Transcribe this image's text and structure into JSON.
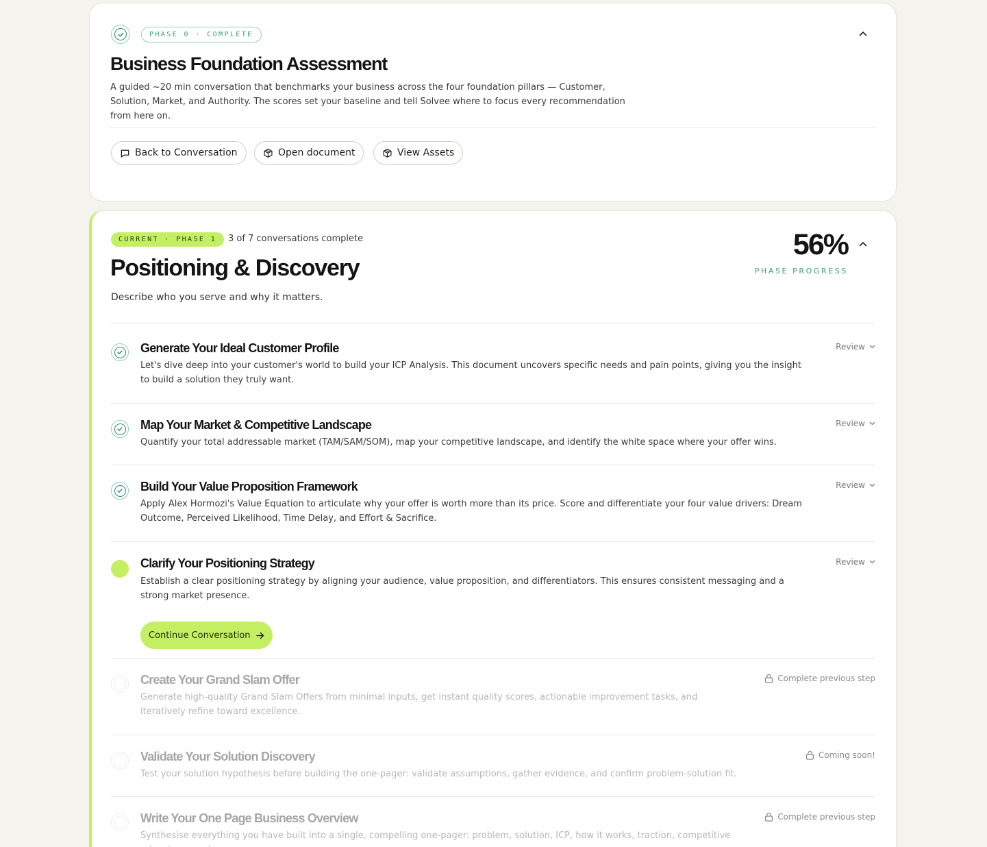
{
  "phase0": {
    "badge": "PHASE 0 · COMPLETE",
    "title": "Business Foundation Assessment",
    "description": "A guided ~20 min conversation that benchmarks your business across the four foundation pillars — Customer, Solution, Market, and Authority. The scores set your baseline and tell Solvee where to focus every recommendation from here on.",
    "buttons": {
      "back": "Back to Conversation",
      "open_document": "Open document",
      "view_assets": "View Assets"
    }
  },
  "phase1": {
    "badge": "CURRENT · PHASE 1",
    "conversations_complete": "3 of 7 conversations complete",
    "title": "Positioning & Discovery",
    "subtitle": "Describe who you serve and why it matters.",
    "progress_value": "56%",
    "progress_label": "PHASE PROGRESS",
    "continue_label": "Continue Conversation",
    "steps": [
      {
        "status": "complete",
        "title": "Generate Your Ideal Customer Profile",
        "description": "Let's dive deep into your customer's world to build your ICP Analysis. This document uncovers specific needs and pain points, giving you the insight to build a solution they truly want.",
        "action": "Review"
      },
      {
        "status": "complete",
        "title": "Map Your Market & Competitive Landscape",
        "description": "Quantify your total addressable market (TAM/SAM/SOM), map your competitive landscape, and identify the white space where your offer wins.",
        "action": "Review"
      },
      {
        "status": "complete",
        "title": "Build Your Value Proposition Framework",
        "description": "Apply Alex Hormozi's Value Equation to articulate why your offer is worth more than its price. Score and differentiate your four value drivers: Dream Outcome, Perceived Likelihood, Time Delay, and Effort & Sacrifice.",
        "action": "Review"
      },
      {
        "status": "active",
        "title": "Clarify Your Positioning Strategy",
        "description": "Establish a clear positioning strategy by aligning your audience, value proposition, and differentiators. This ensures consistent messaging and a strong market presence.",
        "action": "Review"
      },
      {
        "status": "locked",
        "title": "Create Your Grand Slam Offer",
        "description": "Generate high-quality Grand Slam Offers from minimal inputs, get instant quality scores, actionable improvement tasks, and iteratively refine toward excellence.",
        "action": "Complete previous step"
      },
      {
        "status": "locked",
        "title": "Validate Your Solution Discovery",
        "description": "Test your solution hypothesis before building the one-pager: validate assumptions, gather evidence, and confirm problem-solution fit.",
        "action": "Coming soon!"
      },
      {
        "status": "locked",
        "title": "Write Your One Page Business Overview",
        "description": "Synthesise everything you have built into a single, compelling one-pager: problem, solution, ICP, how it works, traction, competitive advantage, and",
        "action": "Complete previous step"
      }
    ]
  },
  "colors": {
    "accent_lime": "#c4ef62",
    "teal": "#3c9a77",
    "background": "#f4f3ee"
  },
  "icons": [
    "check-circle-icon",
    "chevron-up-icon",
    "chevron-down-icon",
    "message-square-icon",
    "box-icon",
    "lock-icon",
    "arrow-right-icon"
  ]
}
